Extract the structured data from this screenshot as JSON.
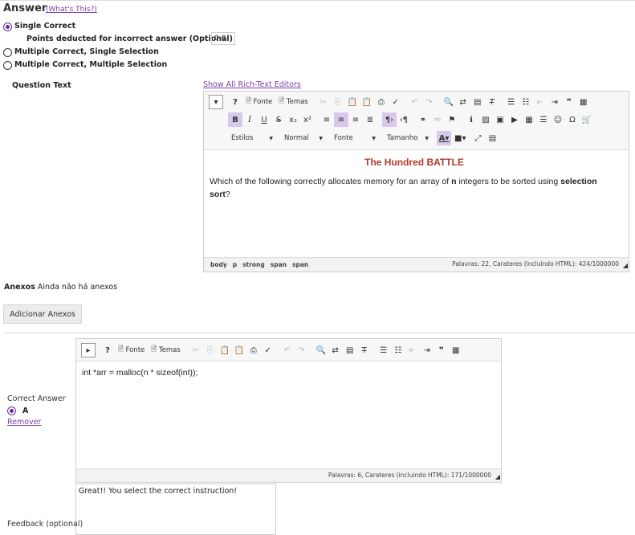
{
  "answer": {
    "title": "Answer",
    "whats_this": "(What's This?)",
    "options": [
      {
        "label": "Single Correct",
        "selected": true
      },
      {
        "label": "Multiple Correct, Single Selection",
        "selected": false
      },
      {
        "label": "Multiple Correct, Multiple Selection",
        "selected": false
      }
    ],
    "points_label": "Points deducted for incorrect answer (Optional)",
    "points_value": "0.0"
  },
  "question": {
    "label": "Question Text",
    "show_all_link": "Show All Rich-Text Editors",
    "toolbar": {
      "source_label": "Fonte",
      "templates_label": "Temas",
      "styles_label": "Estilos",
      "format_label": "Normal",
      "font_label": "Fonte",
      "size_label": "Tamanho"
    },
    "content": {
      "heading": "The Hundred BATTLE",
      "heading_color": "#b1392b",
      "text_1": "Which of the following correctly allocates memory for an array of",
      "text_n": "n",
      "text_2": "integers to be sorted using",
      "text_sel": "selection sort",
      "text_end": "?"
    },
    "status": {
      "path": [
        "body",
        "p",
        "strong",
        "span",
        "span"
      ],
      "count": "Palavras: 22, Carateres (incluindo HTML): 424/1000000"
    }
  },
  "attachments": {
    "label": "Anexos",
    "none_text": "Ainda não há anexos",
    "add_button": "Adicionar Anexos"
  },
  "correct_answer": {
    "label": "Correct Answer",
    "letter": "A",
    "remove_link": "Remover",
    "toolbar": {
      "source_label": "Fonte",
      "templates_label": "Temas"
    },
    "content": "int *arr = malloc(n * sizeof(int));",
    "status_count": "Palavras: 6, Carateres (incluindo HTML): 171/1000000"
  },
  "feedback": {
    "label": "Feedback (optional)",
    "value": "Great!! You select the correct instruction!"
  },
  "colors": {
    "accent": "#7b3fa5",
    "active_button": "#d8c9ea"
  }
}
